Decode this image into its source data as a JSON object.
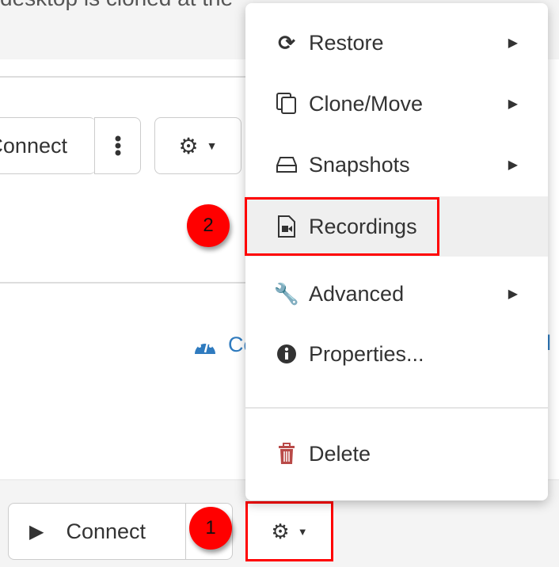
{
  "background": {
    "text": "desktop is cloned at the"
  },
  "card": {
    "connect_label": "Connect"
  },
  "footer": {
    "connect_label": "Connect"
  },
  "link": {
    "partial_text": "Co",
    "partial_text_right": "l"
  },
  "menu": {
    "items": [
      {
        "label": "Restore",
        "icon": "sync-icon",
        "submenu": true
      },
      {
        "label": "Clone/Move",
        "icon": "copy-icon",
        "submenu": true
      },
      {
        "label": "Snapshots",
        "icon": "hdd-icon",
        "submenu": true
      },
      {
        "label": "Recordings",
        "icon": "file-video-icon",
        "submenu": false
      },
      {
        "label": "Advanced",
        "icon": "wrench-icon",
        "submenu": true
      },
      {
        "label": "Properties...",
        "icon": "info-circle-icon",
        "submenu": false
      }
    ],
    "delete_label": "Delete"
  },
  "annotations": {
    "step1": "1",
    "step2": "2",
    "highlight_color": "#ff0000"
  },
  "colors": {
    "delete_icon": "#b94a48",
    "link": "#2f7bbf"
  }
}
